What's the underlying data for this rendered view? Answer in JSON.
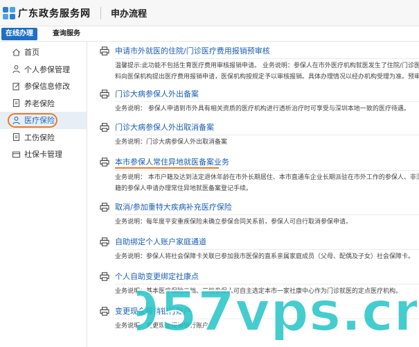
{
  "header": {
    "site_title": "广东政务服务网",
    "section_title": "申办流程"
  },
  "tabs": [
    {
      "label": "在线办理",
      "active": true
    },
    {
      "label": "查询服务",
      "active": false
    }
  ],
  "sidebar": {
    "items": [
      {
        "label": "首页",
        "icon": "home-icon"
      },
      {
        "label": "个人参保管理",
        "icon": "person-icon"
      },
      {
        "label": "参保信息修改",
        "icon": "edit-icon"
      },
      {
        "label": "养老保险",
        "icon": "document-icon"
      },
      {
        "label": "医疗保险",
        "icon": "person-icon",
        "active": true
      },
      {
        "label": "工伤保险",
        "icon": "document-icon"
      },
      {
        "label": "社保卡管理",
        "icon": "card-icon"
      }
    ]
  },
  "services": [
    {
      "title": "申请市外就医的住院/门诊医疗费用报销预审核",
      "desc_lines": [
        "温馨提示:此功能不包括生育医疗费用审核报销申请。 业务说明：参保人在市外医疗机构就医发生了住院/门诊医疗",
        "料向医保机构提出医疗费用报销申请，医保机构按规定予以审核报销。具体办理情况以经办机构受理为准。预审核"
      ]
    },
    {
      "title": "门诊大病参保人外出备案",
      "desc_lines": [
        "业务说明： 参保人申请到市外具有相关资质的医疗机构进行透析治疗时可享受与深圳本地一致的医疗待遇。"
      ]
    },
    {
      "title": "门诊大病参保人外出取消备案",
      "desc_lines": [
        "业务说明：门诊大病参保人外出取消备案"
      ]
    },
    {
      "title": "本市参保人常住异地就医备案业务",
      "highlighted": true,
      "desc_lines": [
        "业务说明： 本市户籍及达到法定退休年龄在市外长期居住、本市直通车企业长期派驻在市外工作的参保人、非深圳",
        "籍的参保人申请办理常住异地就医备案登记手续。"
      ]
    },
    {
      "title": "取消/参加重特大疾病补充医疗保险",
      "desc_lines": [
        "业务说明：每年度平安重疾保险未确立参保合同关系前，参保人可自行取消参保申请。"
      ]
    },
    {
      "title": "自助绑定个人账户家庭通道",
      "desc_lines": [
        "业务说明：参保人将社会保障卡关联已参加我市医保的直系亲属家庭成员（父母、配偶及子女）社会保障卡。"
      ]
    },
    {
      "title": "个人自助变更绑定社康点",
      "desc_lines": [
        "业务说明：基本医疗保险二档、三档参保人可自主选定本市一家社康中心作为门诊就医的定点医疗机构。"
      ]
    },
    {
      "title": "变更现金报销银行账户",
      "desc_lines": [
        "业务说明：变更现金报销银行账户"
      ]
    }
  ],
  "watermark": {
    "text": "957vps.cn"
  },
  "colors": {
    "accent": "#1f6fc5",
    "link": "#1a5fb4",
    "highlight": "#e87b2a",
    "watermark_fill": "#24c3c6"
  }
}
